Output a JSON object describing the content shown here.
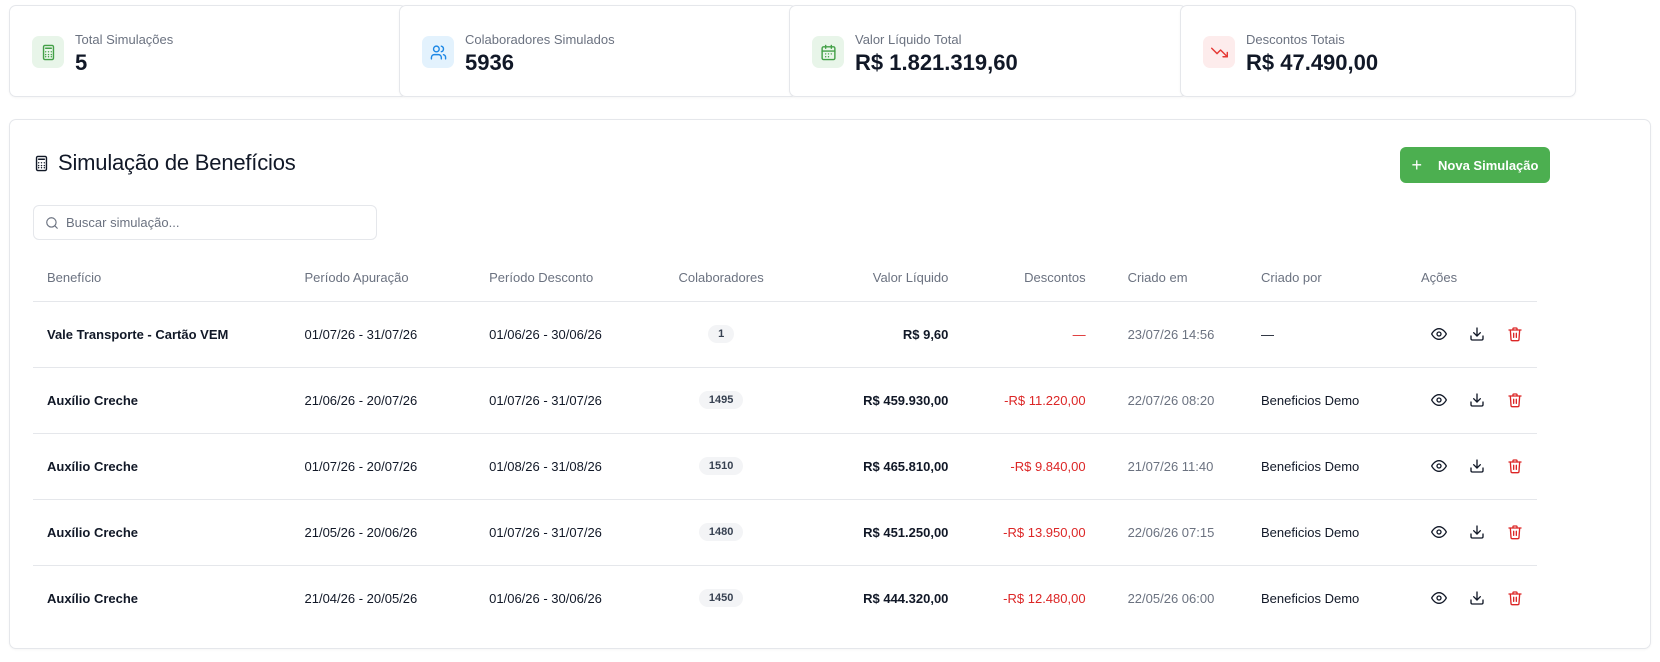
{
  "stats": [
    {
      "label": "Total Simulações",
      "value": "5",
      "icon": "calculator-icon",
      "tone": "green"
    },
    {
      "label": "Colaboradores Simulados",
      "value": "5936",
      "icon": "users-icon",
      "tone": "blue"
    },
    {
      "label": "Valor Líquido Total",
      "value": "R$ 1.821.319,60",
      "icon": "calendar-icon",
      "tone": "green"
    },
    {
      "label": "Descontos Totais",
      "value": "R$ 47.490,00",
      "icon": "trending-down-icon",
      "tone": "red"
    }
  ],
  "panel": {
    "title": "Simulação de Benefícios",
    "new_button": "Nova Simulação",
    "search_placeholder": "Buscar simulação..."
  },
  "table": {
    "headers": [
      "Benefício",
      "Período Apuração",
      "Período Desconto",
      "Colaboradores",
      "Valor Líquido",
      "Descontos",
      "Criado em",
      "Criado por",
      "Ações"
    ],
    "rows": [
      {
        "beneficio": "Vale Transporte - Cartão VEM",
        "apuracao": "01/07/26 - 31/07/26",
        "desconto_periodo": "01/06/26 - 30/06/26",
        "colaboradores": "1",
        "valor": "R$ 9,60",
        "descontos": "—",
        "criado_em": "23/07/26 14:56",
        "criado_por": "—"
      },
      {
        "beneficio": "Auxílio Creche",
        "apuracao": "21/06/26 - 20/07/26",
        "desconto_periodo": "01/07/26 - 31/07/26",
        "colaboradores": "1495",
        "valor": "R$ 459.930,00",
        "descontos": "-R$ 11.220,00",
        "criado_em": "22/07/26 08:20",
        "criado_por": "Beneficios Demo"
      },
      {
        "beneficio": "Auxílio Creche",
        "apuracao": "01/07/26 - 20/07/26",
        "desconto_periodo": "01/08/26 - 31/08/26",
        "colaboradores": "1510",
        "valor": "R$ 465.810,00",
        "descontos": "-R$ 9.840,00",
        "criado_em": "21/07/26 11:40",
        "criado_por": "Beneficios Demo"
      },
      {
        "beneficio": "Auxílio Creche",
        "apuracao": "21/05/26 - 20/06/26",
        "desconto_periodo": "01/07/26 - 31/07/26",
        "colaboradores": "1480",
        "valor": "R$ 451.250,00",
        "descontos": "-R$ 13.950,00",
        "criado_em": "22/06/26 07:15",
        "criado_por": "Beneficios Demo"
      },
      {
        "beneficio": "Auxílio Creche",
        "apuracao": "21/04/26 - 20/05/26",
        "desconto_periodo": "01/06/26 - 30/06/26",
        "colaboradores": "1450",
        "valor": "R$ 444.320,00",
        "descontos": "-R$ 12.480,00",
        "criado_em": "22/05/26 06:00",
        "criado_por": "Beneficios Demo"
      }
    ]
  },
  "colors": {
    "accent_green": "#4caf50",
    "danger_red": "#dc2626",
    "icon_green_bg": "#e8f5e9",
    "icon_blue_bg": "#e3f2fd",
    "icon_red_bg": "#fdecec"
  }
}
